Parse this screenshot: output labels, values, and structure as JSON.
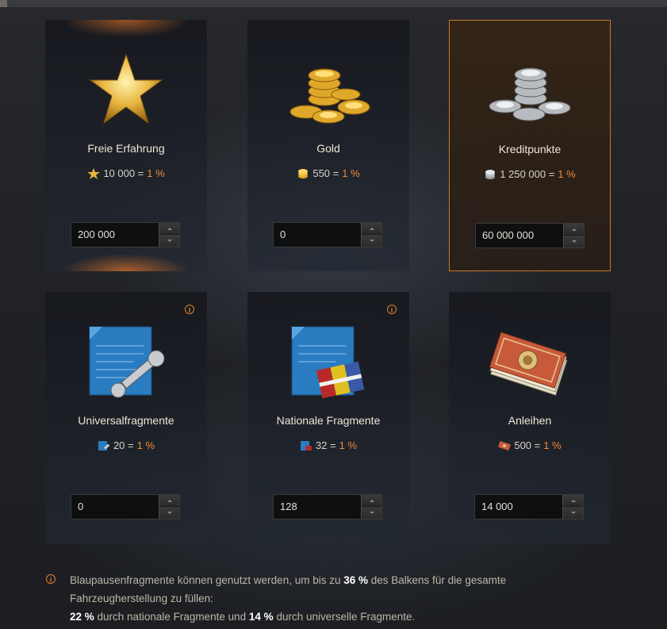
{
  "colors": {
    "accent": "#f08a38",
    "active_border": "#c57a22",
    "info": "#e0802c"
  },
  "cards": [
    {
      "title": "Freie Erfahrung",
      "icon": "star-icon",
      "rate_value": "10 000 =",
      "rate_pct": "1 %",
      "input": "200 000"
    },
    {
      "title": "Gold",
      "icon": "gold-coins-icon",
      "rate_value": "550 =",
      "rate_pct": "1 %",
      "input": "0"
    },
    {
      "title": "Kreditpunkte",
      "icon": "silver-coins-icon",
      "rate_value": "1 250 000 =",
      "rate_pct": "1 %",
      "input": "60 000 000"
    },
    {
      "title": "Universalfragmente",
      "icon": "blueprint-wrench-icon",
      "rate_value": "20 =",
      "rate_pct": "1 %",
      "input": "0",
      "info": "i"
    },
    {
      "title": "Nationale Fragmente",
      "icon": "blueprint-flags-icon",
      "rate_value": "32 =",
      "rate_pct": "1 %",
      "input": "128",
      "info": "i"
    },
    {
      "title": "Anleihen",
      "icon": "bonds-icon",
      "rate_value": "500 =",
      "rate_pct": "1 %",
      "input": "14 000"
    }
  ],
  "note": {
    "icon": "i",
    "part1": "Blaupausenfragmente können genutzt werden, um bis zu ",
    "b1": "36 %",
    "part2": " des Balkens für die gesamte Fahrzeugherstellung zu füllen:",
    "b2": "22 %",
    "part3": " durch nationale Fragmente und ",
    "b3": "14 %",
    "part4": " durch universelle Fragmente."
  }
}
